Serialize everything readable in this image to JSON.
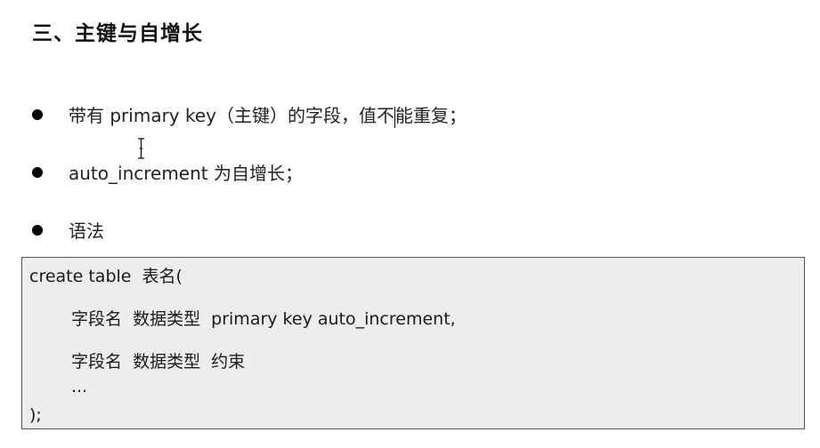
{
  "heading": "三、主键与自增长",
  "bullets": [
    {
      "before": "带有 primary key（主键）的字段，值不",
      "after": "能重复；"
    },
    {
      "text": "auto_increment 为自增长；"
    },
    {
      "text": "语法"
    }
  ],
  "code": {
    "line1": "create table  表名(",
    "line2": "字段名  数据类型  primary key auto_increment,",
    "line3": "字段名  数据类型  约束",
    "line4": "...",
    "line5": ");"
  }
}
